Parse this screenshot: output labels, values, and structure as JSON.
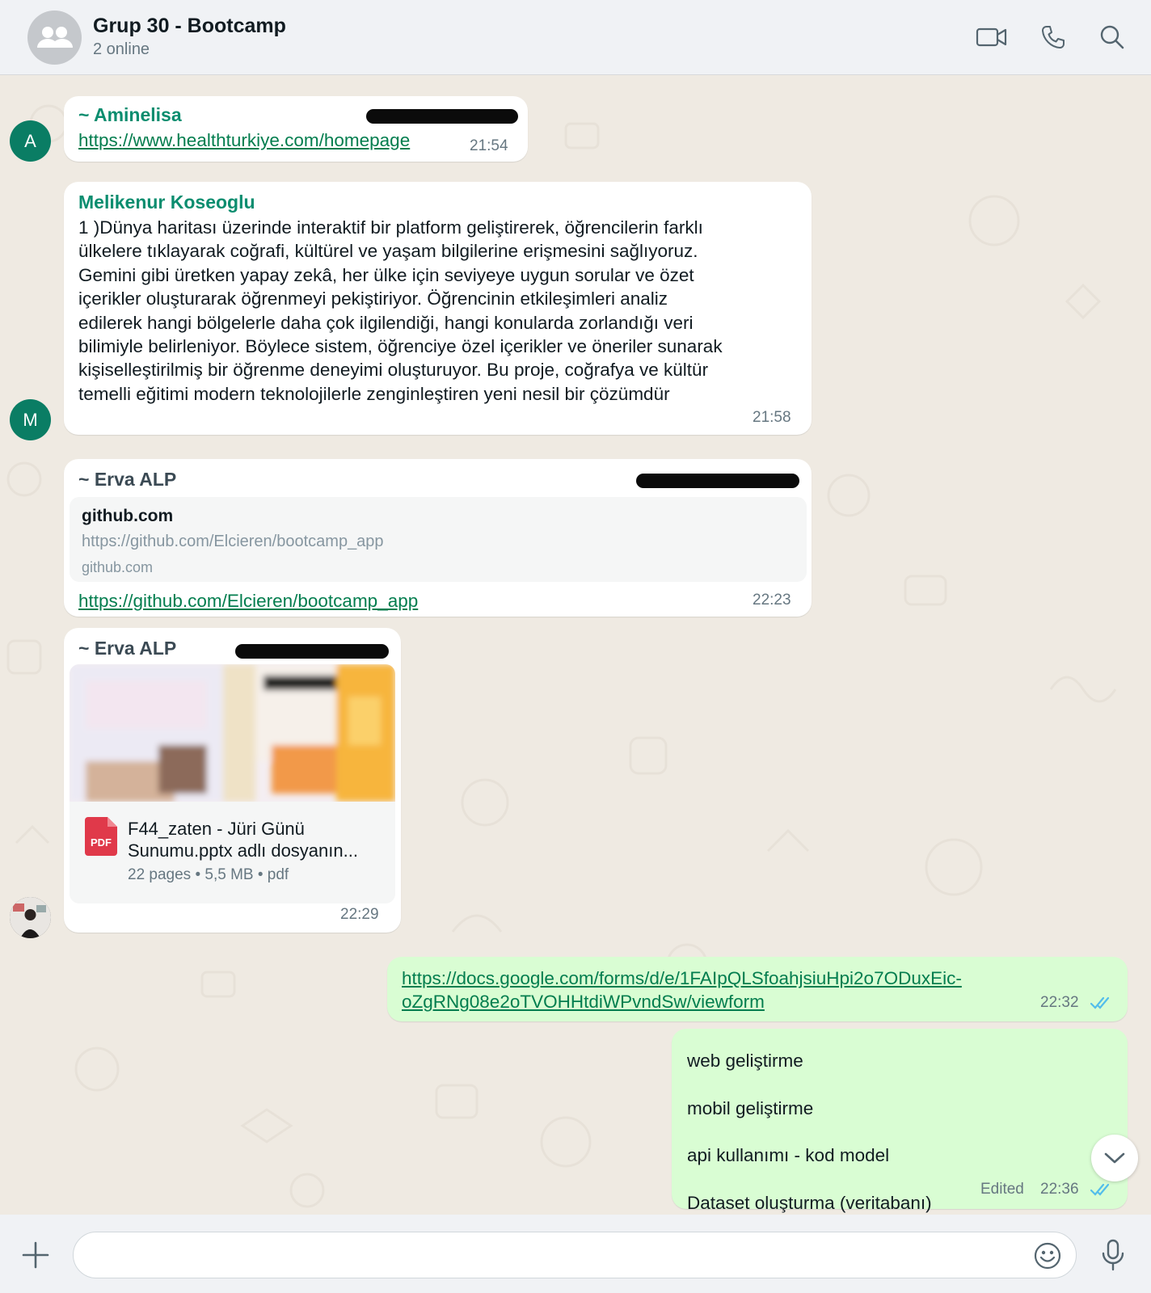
{
  "header": {
    "title": "Grup 30 - Bootcamp",
    "subtitle": "2 online",
    "icons": [
      "group-avatar-icon",
      "video-call-icon",
      "voice-call-icon",
      "search-icon"
    ]
  },
  "messages": [
    {
      "sender": "~ Aminelisa",
      "avatar_letter": "A",
      "link": "https://www.healthturkiye.com/homepage",
      "time": "21:54"
    },
    {
      "sender": "Melikenur Koseoglu",
      "avatar_letter": "M",
      "lines": [
        "1 )Dünya haritası üzerinde interaktif bir platform geliştirerek, öğrencilerin farklı",
        "ülkelere tıklayarak coğrafi, kültürel ve yaşam bilgilerine erişmesini sağlıyoruz.",
        "Gemini gibi üretken yapay zekâ, her ülke için seviyeye uygun sorular ve özet",
        "içerikler oluşturarak öğrenmeyi pekiştiriyor. Öğrencinin etkileşimleri analiz",
        "edilerek hangi bölgelerle daha çok ilgilendiği, hangi konularda zorlandığı veri",
        "bilimiyle belirleniyor. Böylece sistem, öğrenciye özel içerikler ve öneriler sunarak",
        "kişiselleştirilmiş bir öğrenme deneyimi oluşturuyor. Bu proje, coğrafya ve kültür",
        "temelli eğitimi modern teknolojilerle zenginleştiren yeni nesil bir çözümdür"
      ],
      "time": "21:58"
    },
    {
      "sender": "~ Erva ALP",
      "preview": {
        "title": "github.com",
        "url": "https://github.com/Elcieren/bootcamp_app",
        "domain": "github.com"
      },
      "link": "https://github.com/Elcieren/bootcamp_app",
      "time": "22:23"
    },
    {
      "sender": "~ Erva ALP",
      "document": {
        "icon_label": "PDF",
        "name_line1": "F44_zaten - Jüri Günü",
        "name_line2": "Sunumu.pptx adlı dosyanın...",
        "meta": "22 pages • 5,5 MB • pdf"
      },
      "time": "22:29"
    },
    {
      "outgoing": true,
      "link_line1": "https://docs.google.com/forms/d/e/1FAIpQLSfoahjsiuHpi2o7ODuxEic-",
      "link_line2": "oZgRNg08e2oTVOHHtdiWPvndSw/viewform",
      "time": "22:32",
      "status": "read"
    },
    {
      "outgoing": true,
      "lines": [
        "web geliştirme",
        "mobil geliştirme",
        "api kullanımı - kod model",
        "Dataset oluşturma (veritabanı)"
      ],
      "edited_label": "Edited",
      "time": "22:36",
      "status": "read"
    }
  ],
  "composer": {
    "placeholder": "",
    "icons": [
      "plus-icon",
      "emoji-icon",
      "microphone-icon"
    ]
  },
  "colors": {
    "header_bg": "#f0f2f5",
    "chat_bg": "#efeae2",
    "incoming_bubble": "#ffffff",
    "outgoing_bubble": "#d9fdd3",
    "sender_green": "#0a8d6f",
    "link_green": "#027d4e",
    "read_tick_blue": "#53bdeb"
  }
}
